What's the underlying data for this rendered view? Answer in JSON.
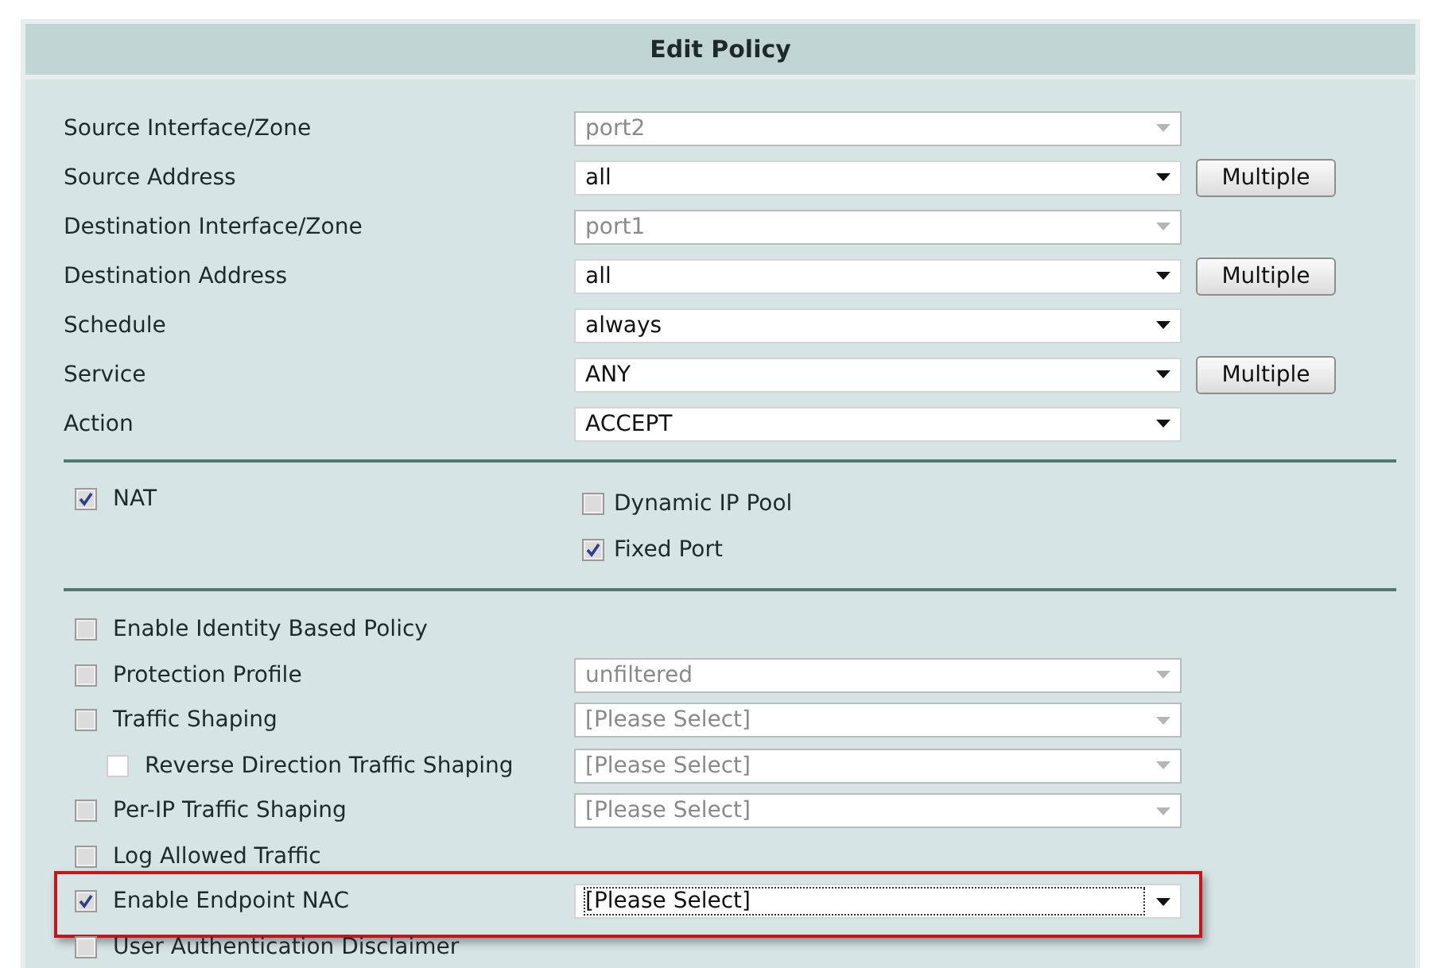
{
  "dialog": {
    "title": "Edit Policy"
  },
  "fields": [
    {
      "label": "Source Interface/Zone",
      "value": "port2",
      "disabled": true
    },
    {
      "label": "Source Address",
      "value": "all",
      "disabled": false,
      "button": "Multiple"
    },
    {
      "label": "Destination Interface/Zone",
      "value": "port1",
      "disabled": true
    },
    {
      "label": "Destination Address",
      "value": "all",
      "disabled": false,
      "button": "Multiple"
    },
    {
      "label": "Schedule",
      "value": "always",
      "disabled": false
    },
    {
      "label": "Service",
      "value": "ANY",
      "disabled": false,
      "button": "Multiple"
    },
    {
      "label": "Action",
      "value": "ACCEPT",
      "disabled": false
    }
  ],
  "nat": {
    "label": "NAT",
    "checked": true
  },
  "nat_options": [
    {
      "label": "Dynamic IP Pool",
      "checked": false
    },
    {
      "label": "Fixed Port",
      "checked": true
    }
  ],
  "options": [
    {
      "label": "Enable Identity Based Policy",
      "checked": false
    },
    {
      "label": "Protection Profile",
      "checked": false,
      "select": {
        "value": "unfiltered",
        "disabled": true
      }
    },
    {
      "label": "Traffic Shaping",
      "checked": false,
      "select": {
        "value": "[Please Select]",
        "disabled": true
      },
      "children": [
        {
          "label": "Reverse Direction Traffic Shaping",
          "checked": false,
          "disabled": true,
          "select": {
            "value": "[Please Select]",
            "disabled": true
          }
        }
      ]
    },
    {
      "label": "Per-IP Traffic Shaping",
      "checked": false,
      "select": {
        "value": "[Please Select]",
        "disabled": true
      }
    },
    {
      "label": "Log Allowed Traffic",
      "checked": false
    },
    {
      "label": "Enable Endpoint NAC",
      "checked": true,
      "highlighted": true,
      "select": {
        "value": "[Please Select]",
        "disabled": false,
        "focused": true
      }
    },
    {
      "label": "User Authentication Disclaimer",
      "checked": false
    }
  ]
}
